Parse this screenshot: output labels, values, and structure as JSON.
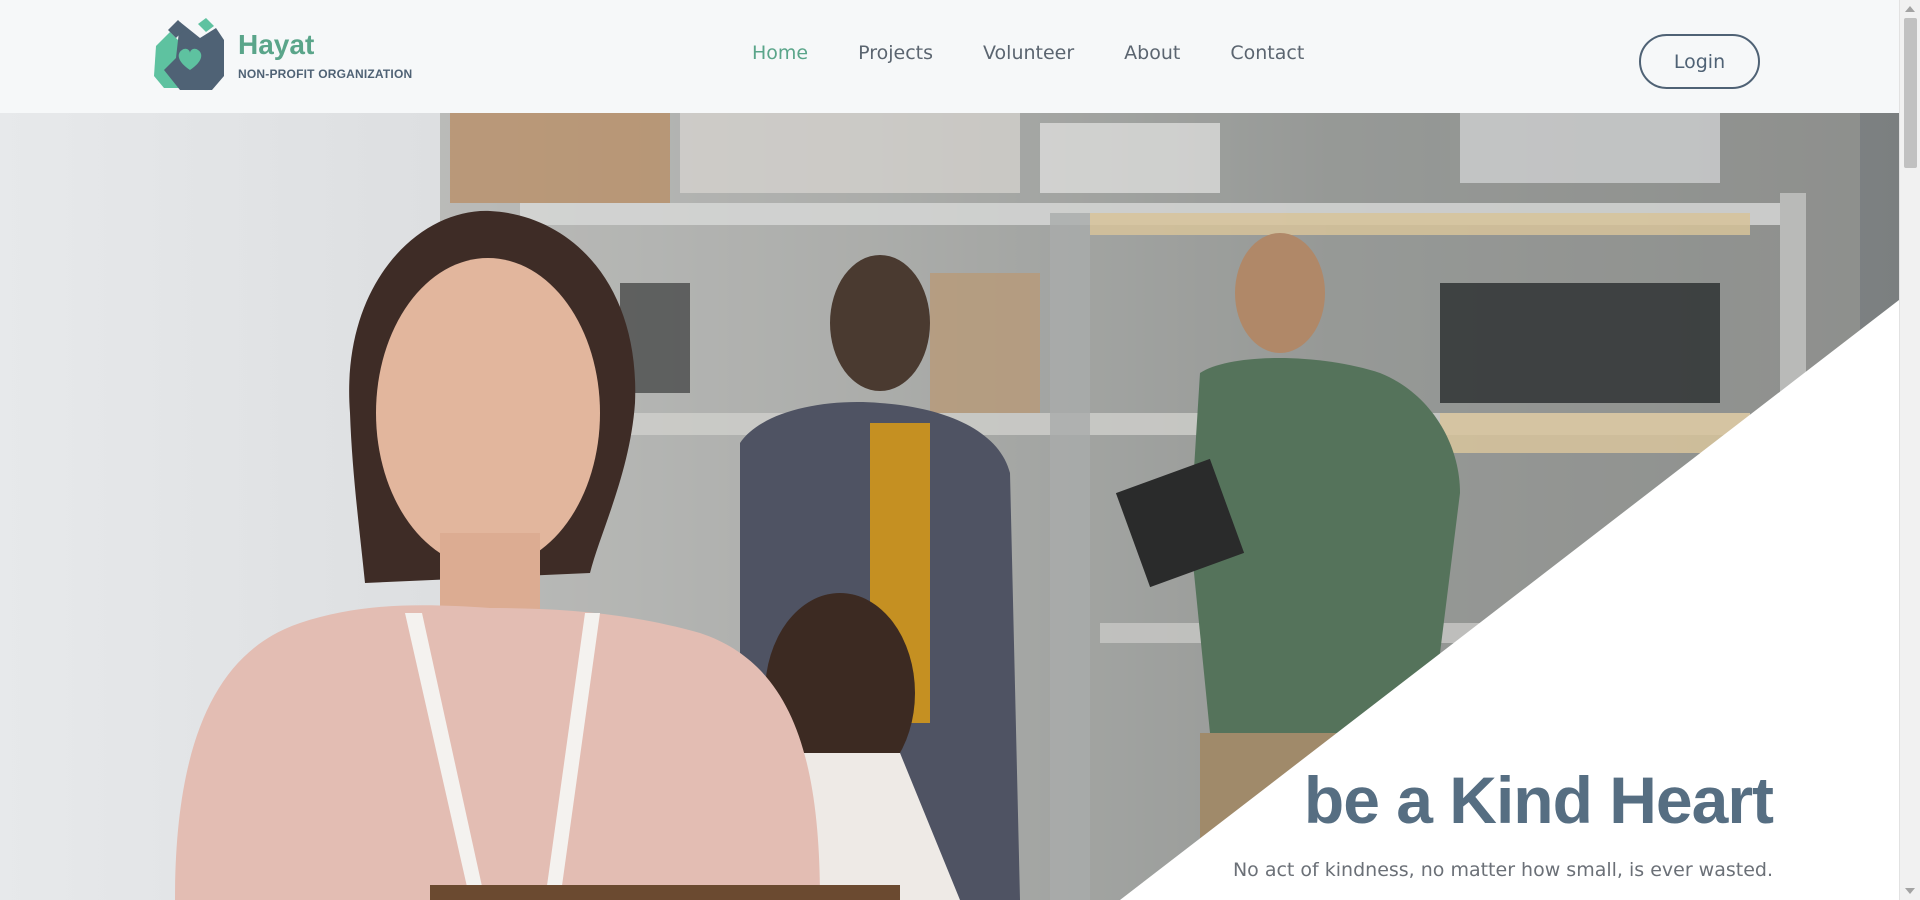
{
  "brand": {
    "name": "Hayat",
    "tagline": "NON-PROFIT ORGANIZATION"
  },
  "nav": {
    "items": [
      {
        "label": "Home",
        "active": true
      },
      {
        "label": "Projects",
        "active": false
      },
      {
        "label": "Volunteer",
        "active": false
      },
      {
        "label": "About",
        "active": false
      },
      {
        "label": "Contact",
        "active": false
      }
    ],
    "login_label": "Login"
  },
  "hero": {
    "title": "be a Kind Heart",
    "subtitle": "No act of kindness, no matter how small, is ever wasted."
  },
  "colors": {
    "accent": "#5aa58a",
    "primary": "#4f6275",
    "hero_title": "#566e82"
  },
  "icons": {
    "logo": "hands-heart-icon"
  }
}
